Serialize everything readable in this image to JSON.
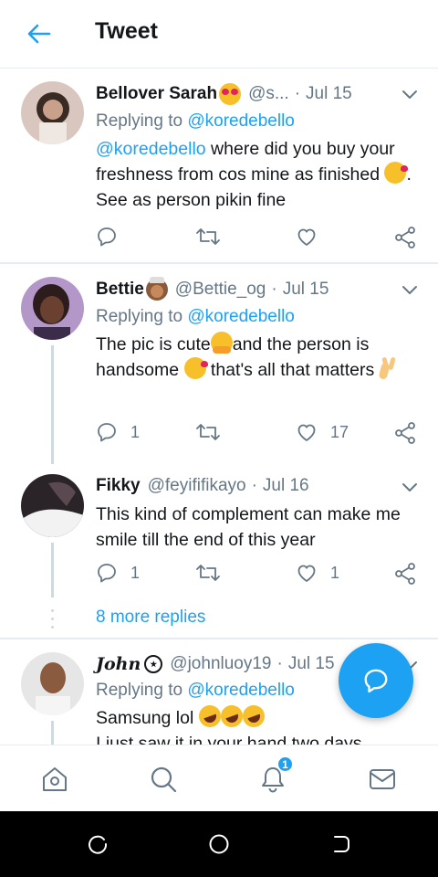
{
  "header": {
    "title": "Tweet",
    "back_icon": "arrow-left-icon"
  },
  "colors": {
    "accent": "#1da1f2",
    "muted": "#657786",
    "text": "#14171a",
    "divider": "#e6ecf0"
  },
  "tweets": [
    {
      "name": "Bellover Sarah",
      "handle": "@s...",
      "date": "Jul 15",
      "replying_label": "Replying to",
      "replying_to": "@koredebello",
      "body_mention": "@koredebello",
      "body_1": "where did you buy your freshness from cos mine as finished",
      "body_2": ". See as person pikin fine",
      "reply_count": "",
      "retweet_count": "",
      "like_count": ""
    },
    {
      "name": "Bettie",
      "handle": "@Bettie_og",
      "date": "Jul 15",
      "replying_label": "Replying to",
      "replying_to": "@koredebello",
      "body_1": "The pic is cute",
      "body_2": "and the person is handsome",
      "body_3": "that's all that matters",
      "reply_count": "1",
      "retweet_count": "",
      "like_count": "17"
    },
    {
      "name": "Fikky",
      "handle": "@feyififikayo",
      "date": "Jul 16",
      "body_1": "This kind of complement can make me smile till the end of this year",
      "reply_count": "1",
      "retweet_count": "",
      "like_count": "1"
    },
    {
      "name": "John",
      "handle": "@johnluoy19",
      "date": "Jul 15",
      "replying_label": "Replying to",
      "replying_to": "@koredebello",
      "body_1": "Samsung lol",
      "body_2": "I just saw it in your hand two days"
    }
  ],
  "more_replies": "8 more replies",
  "notifications_badge": "1",
  "nav": [
    "home-icon",
    "search-icon",
    "bell-icon",
    "mail-icon"
  ]
}
